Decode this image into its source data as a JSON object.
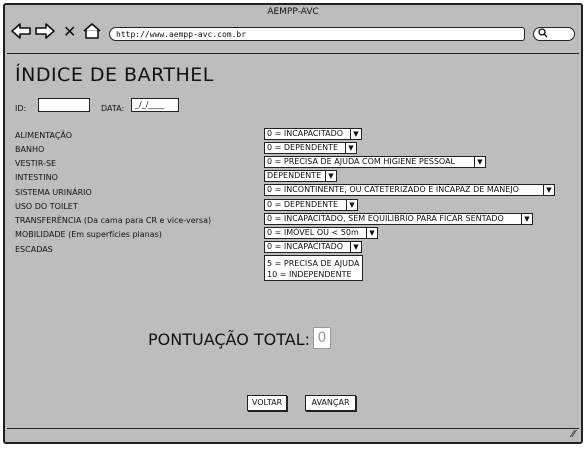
{
  "window": {
    "title": "AEMPP-AVC"
  },
  "browser": {
    "url": "http://www.aempp-avc.com.br",
    "icons": [
      "back-arrow-icon",
      "forward-arrow-icon",
      "close-icon",
      "home-icon",
      "search-icon",
      "resize-grip-icon"
    ]
  },
  "page": {
    "title": "ÍNDICE DE BARTHEL",
    "id_label": "ID:",
    "data_label": "DATA:",
    "data_value": "_/_/____"
  },
  "items": [
    {
      "label": "ALIMENTAÇÃO",
      "selected": "0 = INCAPACITADO"
    },
    {
      "label": "BANHO",
      "selected": "0 = DEPENDENTE"
    },
    {
      "label": "VESTIR-SE",
      "selected": "0 = PRECISA DE AJUDA COM HIGIENE PESSOAL"
    },
    {
      "label": "INTESTINO",
      "selected": "DEPENDENTE"
    },
    {
      "label": "SISTEMA URINÁRIO",
      "selected": "0 = INCONTINENTE, OU CATETERIZADO E INCAPAZ DE MANEJO"
    },
    {
      "label": "USO DO TOILET",
      "selected": "0 = DEPENDENTE"
    },
    {
      "label": "TRANSFERÊNCIA (Da cama para CR e vice-versa)",
      "selected": "0 = INCAPACITADO, SEM EQUILIBRIO PARA FICAR SENTADO"
    },
    {
      "label": "MOBILIDADE (Em superfícies planas)",
      "selected": "0 = IMÓVEL OU < 50m"
    },
    {
      "label": "ESCADAS",
      "selected": "0 = INCAPACITADO"
    }
  ],
  "escadas_options": [
    "5 = PRECISA DE AJUDA",
    "10 = INDEPENDENTE"
  ],
  "total": {
    "label": "PONTUAÇÃO TOTAL:",
    "value": "0"
  },
  "buttons": {
    "back": "VOLTAR",
    "next": "AVANÇAR"
  }
}
